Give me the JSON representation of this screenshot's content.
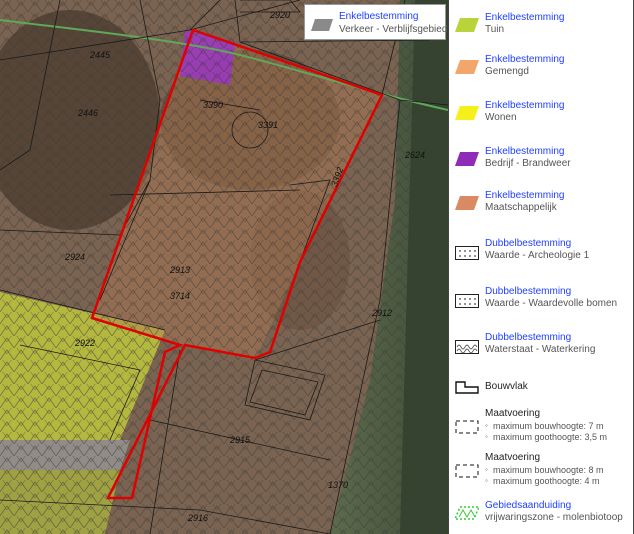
{
  "map": {
    "parcels": [
      "2920",
      "2445",
      "3390",
      "3391",
      "2446",
      "2624",
      "3392",
      "2924",
      "2913",
      "3714",
      "2912",
      "2922",
      "2915",
      "1370",
      "2916"
    ]
  },
  "legend_overlay": {
    "title": "Enkelbestemming",
    "subtitle": "Verkeer - Verblijfsgebied",
    "color": "#8a8a8a"
  },
  "legend": {
    "items": [
      {
        "title": "Enkelbestemming",
        "subtitle": "Tuin",
        "color": "#b8d43a"
      },
      {
        "title": "Enkelbestemming",
        "subtitle": "Gemengd",
        "color": "#f2a66b"
      },
      {
        "title": "Enkelbestemming",
        "subtitle": "Wonen",
        "color": "#f5f01a"
      },
      {
        "title": "Enkelbestemming",
        "subtitle": "Bedrijf - Brandweer",
        "color": "#8e2bb8"
      },
      {
        "title": "Enkelbestemming",
        "subtitle": "Maatschappelijk",
        "color": "#d98a63"
      },
      {
        "title": "Dubbelbestemming",
        "subtitle": "Waarde - Archeologie 1",
        "icon": "dotted-box-icon"
      },
      {
        "title": "Dubbelbestemming",
        "subtitle": "Waarde - Waardevolle bomen",
        "icon": "dotted-box-icon"
      },
      {
        "title": "Dubbelbestemming",
        "subtitle": "Waterstaat - Waterkering",
        "icon": "wave-box-icon"
      }
    ],
    "bouwvlak": "Bouwvlak",
    "maatvoering1": {
      "title": "Maatvoering",
      "line1": "maximum bouwhoogte: 7 m",
      "line2": "maximum goothoogte: 3,5 m"
    },
    "maatvoering2": {
      "title": "Maatvoering",
      "line1": "maximum bouwhoogte: 8 m",
      "line2": "maximum goothoogte: 4 m"
    },
    "gebied": {
      "title": "Gebiedsaanduiding",
      "subtitle": "vrijwaringszone - molenbiotoop",
      "color": "#33cc33"
    }
  }
}
